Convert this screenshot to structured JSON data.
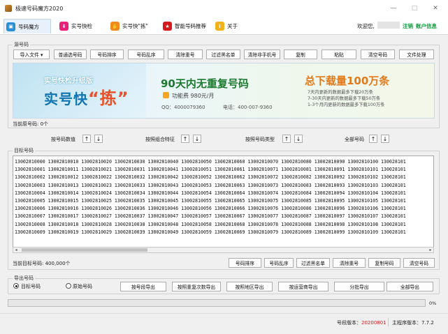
{
  "window": {
    "title": "极速号码魔方2020"
  },
  "tabs": [
    {
      "label": "号码魔方",
      "color": "#2b8fd6"
    },
    {
      "label": "实号快检",
      "color": "#e8207a"
    },
    {
      "label": "实号快\"拣\"",
      "color": "#f08a1c"
    },
    {
      "label": "智能号码推荐",
      "color": "#d41c1c"
    },
    {
      "label": "关于",
      "color": "#f2b21c"
    }
  ],
  "header": {
    "welcome": "欢迎您,",
    "register": "注销",
    "account": "账户信息"
  },
  "source_group": {
    "legend": "源号码",
    "buttons": [
      "导入文件 ▾",
      "普通选号码",
      "号码排序",
      "号码乱序",
      "清除重号",
      "过滤黑名单",
      "清除非手机号",
      "复制",
      "粘贴",
      "清空号码",
      "文件处理"
    ],
    "count_label": "当前原号码: 0个"
  },
  "banner": {
    "subtitle": "实号快检升级版",
    "main1": "实号快",
    "main2": "“拣”",
    "headline": "90天内无重复号码",
    "price": "功能费 980元/月",
    "contact_qq": "QQ：4000079360",
    "contact_tel": "电话：400-007-9360",
    "right_title": "总下载量100万条",
    "right_lines": [
      "7天内更新的数据最多下载20万条",
      "7-30天内更新的数据最多下载50万条",
      "1-3个月内更新的数据最多下载100万条"
    ]
  },
  "sort_bar": {
    "by_value": "按号码数值",
    "by_feature": "按照组合特征",
    "by_type": "按照号码类型",
    "all": "全部号码"
  },
  "target_group": {
    "legend": "目标号码",
    "rows": [
      "13002810000 13002810010 13002810020 13002810030 13002810040 13002810050 13002810060 13002810070 13002810080 13002810090 13002810100 130028101",
      "13002810001 13002810011 13002810021 13002810031 13002810041 13002810051 13002810061 13002810071 13002810081 13002810091 13002810101 130028101",
      "13002810002 13002810012 13002810022 13002810032 13002810042 13002810052 13002810062 13002810072 13002810082 13002810092 13002810102 130028101",
      "13002810003 13002810013 13002810023 13002810033 13002810043 13002810053 13002810063 13002810073 13002810083 13002810093 13002810103 130028101",
      "13002810004 13002810014 13002810024 13002810034 13002810044 13002810054 13002810064 13002810074 13002810084 13002810094 13002810104 130028101",
      "13002810005 13002810015 13002810025 13002810035 13002810045 13002810055 13002810065 13002810075 13002810085 13002810095 13002810105 130028101",
      "13002810006 13002810016 13002810026 13002810036 13002810046 13002810056 13002810066 13002810076 13002810086 13002810096 13002810106 130028101",
      "13002810007 13002810017 13002810027 13002810037 13002810047 13002810057 13002810067 13002810077 13002810087 13002810097 13002810107 130028101",
      "13002810008 13002810018 13002810028 13002810038 13002810048 13002810058 13002810068 13002810078 13002810088 13002810098 13002810108 130028101",
      "13002810009 13002810019 13002810029 13002810039 13002810049 13002810059 13002810069 13002810079 13002810089 13002810099 13002810109 130028101"
    ],
    "count_label": "当前目标号码: 400,000个",
    "buttons": [
      "号码排序",
      "号码乱序",
      "过滤黑名单",
      "清除重号",
      "复制号码",
      "清空号码"
    ]
  },
  "export_group": {
    "legend": "导出号码",
    "radio_target": "目标号码",
    "radio_source": "原始号码",
    "buttons": [
      "按号段导出",
      "按照重复次数导出",
      "按照地区导出",
      "按运营商导出",
      "分批导出",
      "全部导出"
    ]
  },
  "progress": {
    "percent_label": "0%",
    "value": 0
  },
  "status": {
    "version_label": "号段版本：",
    "version_value": "20200801",
    "main_label": "主程序版本：",
    "main_value": "7.7.2"
  }
}
